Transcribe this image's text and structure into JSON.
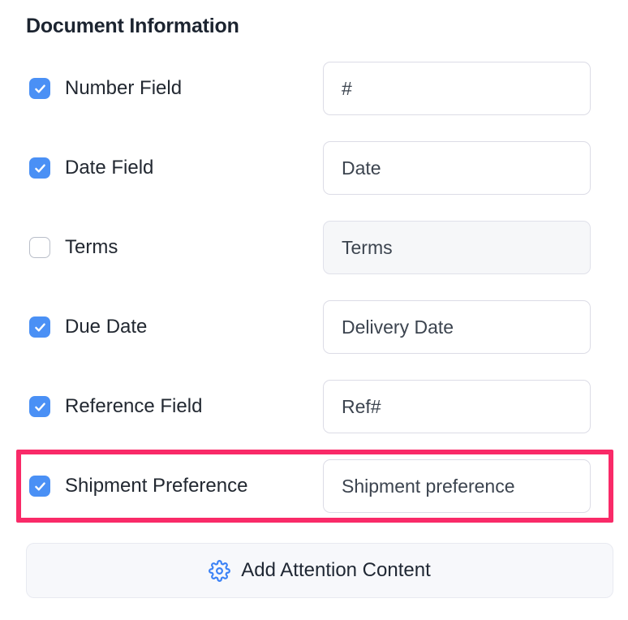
{
  "section": {
    "title": "Document Information"
  },
  "colors": {
    "checkbox_blue": "#4a90f5",
    "highlight_pink": "#f92a68",
    "icon_blue": "#3b82f6",
    "text_dark": "#222831",
    "input_border": "#dcdce6",
    "disabled_bg": "#f6f7f9"
  },
  "rows": [
    {
      "id": "number-field",
      "label": "Number Field",
      "checked": true,
      "input_value": "#",
      "input_disabled": false,
      "highlighted": false
    },
    {
      "id": "date-field",
      "label": "Date Field",
      "checked": true,
      "input_value": "Date",
      "input_disabled": false,
      "highlighted": false
    },
    {
      "id": "terms",
      "label": "Terms",
      "checked": false,
      "input_value": "Terms",
      "input_disabled": true,
      "highlighted": false
    },
    {
      "id": "due-date",
      "label": "Due Date",
      "checked": true,
      "input_value": "Delivery Date",
      "input_disabled": false,
      "highlighted": false
    },
    {
      "id": "reference-field",
      "label": "Reference Field",
      "checked": true,
      "input_value": "Ref#",
      "input_disabled": false,
      "highlighted": false
    },
    {
      "id": "shipment-preference",
      "label": "Shipment Preference",
      "checked": true,
      "input_value": "Shipment preference",
      "input_disabled": false,
      "highlighted": true
    }
  ],
  "add_button": {
    "label": "Add Attention Content",
    "icon": "gear-icon"
  }
}
